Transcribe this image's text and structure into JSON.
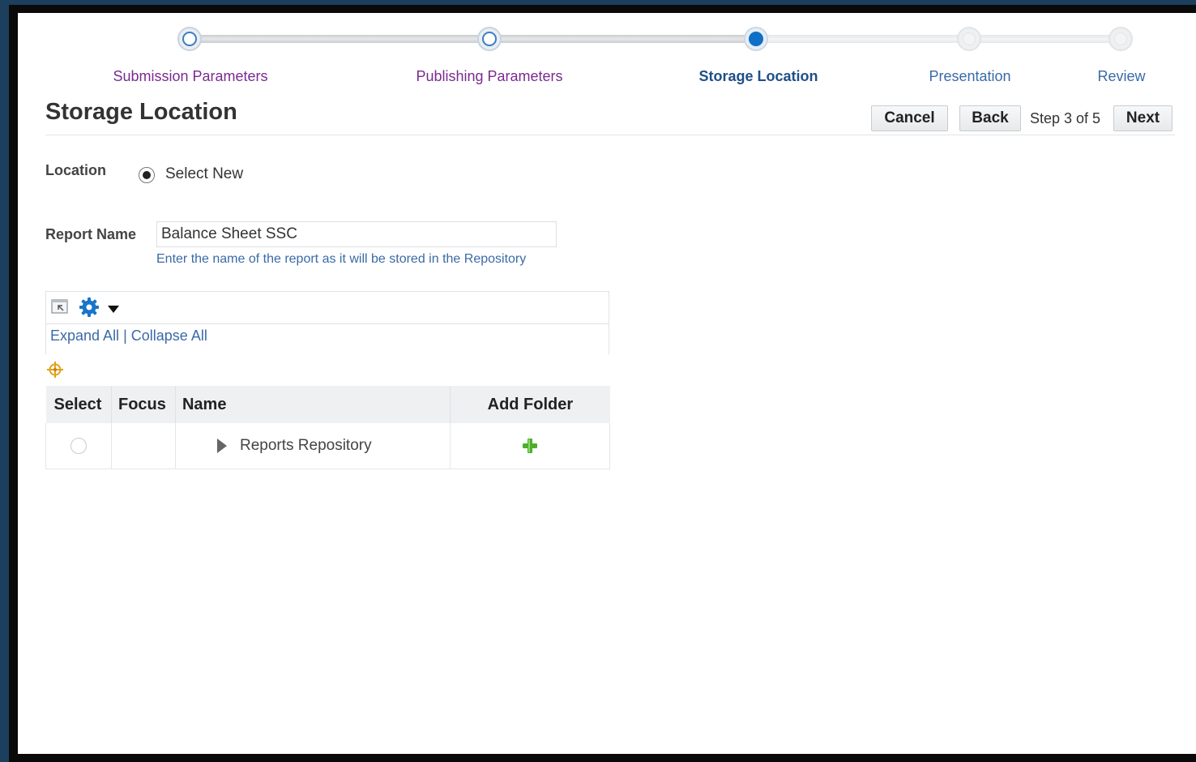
{
  "train": {
    "steps": [
      {
        "label": "Submission Parameters",
        "state": "visited"
      },
      {
        "label": "Publishing Parameters",
        "state": "visited"
      },
      {
        "label": "Storage Location",
        "state": "current"
      },
      {
        "label": "Presentation",
        "state": "future"
      },
      {
        "label": "Review",
        "state": "future"
      }
    ]
  },
  "header": {
    "title": "Storage Location",
    "cancel_label": "Cancel",
    "back_label": "Back",
    "step_text": "Step 3 of 5",
    "next_label": "Next"
  },
  "form": {
    "location_label": "Location",
    "location_option": "Select New",
    "report_name_label": "Report Name",
    "report_name_value": "Balance Sheet SSC",
    "report_name_hint": "Enter the name of the report as it will be stored in the Repository"
  },
  "tree_toolbar": {
    "expand_all": "Expand All",
    "separator": "|",
    "collapse_all": "Collapse All"
  },
  "tree_table": {
    "columns": [
      "Select",
      "Focus",
      "Name",
      "Add Folder"
    ],
    "rows": [
      {
        "name": "Reports Repository"
      }
    ]
  },
  "colors": {
    "visited_link": "#7a2b8f",
    "link": "#3a6aa6",
    "current_step": "#0f70c6",
    "add_icon": "#4caf2c"
  }
}
